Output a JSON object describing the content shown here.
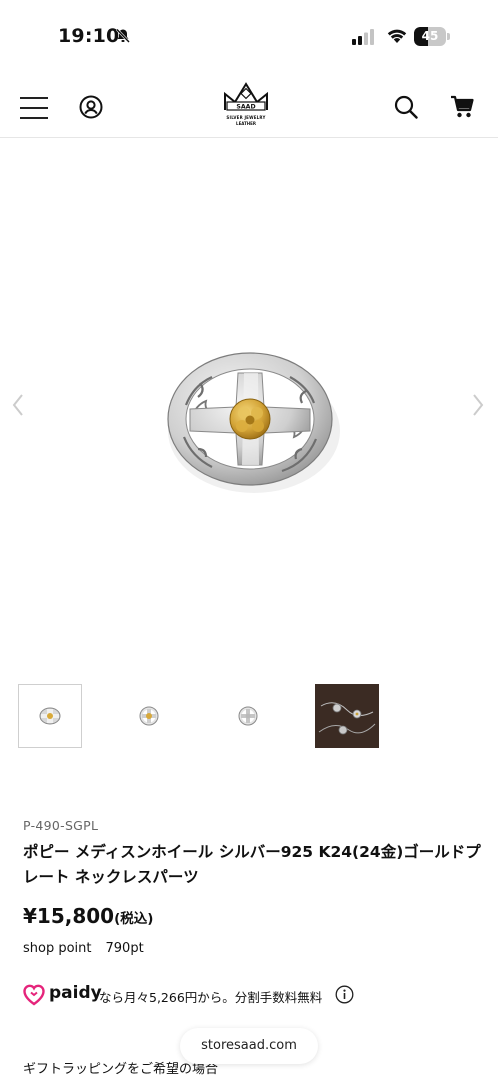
{
  "status_bar": {
    "time": "19:10",
    "battery": "45",
    "battery_level": 0.45,
    "icons": [
      "bell-slash-icon",
      "cellular-signal-icon",
      "wifi-icon",
      "battery-icon"
    ]
  },
  "header": {
    "logo_name": "SAAD",
    "logo_line_1": "SILVER JEWELRY",
    "logo_line_2": "LEATHER",
    "icons": [
      "menu-icon",
      "account-icon",
      "search-icon",
      "cart-icon"
    ]
  },
  "gallery": {
    "thumbnail_count": 4,
    "active_thumbnail": 0
  },
  "product": {
    "sku": "P-490-SGPL",
    "title": "ポピー メディスンホイール シルバー925 K24(24金)ゴールドプレート ネックレスパーツ",
    "price": "¥15,800",
    "tax_label": "(税込)",
    "points_label": "shop point",
    "points_value": "790pt"
  },
  "paidy": {
    "brand": "paidy",
    "text": "なら月々5,266円から。分割手数料無料",
    "color": "#e5247b"
  },
  "browser": {
    "domain": "storesaad.com"
  },
  "gift": {
    "text": "ギフトラッピングをご希望の場合"
  }
}
